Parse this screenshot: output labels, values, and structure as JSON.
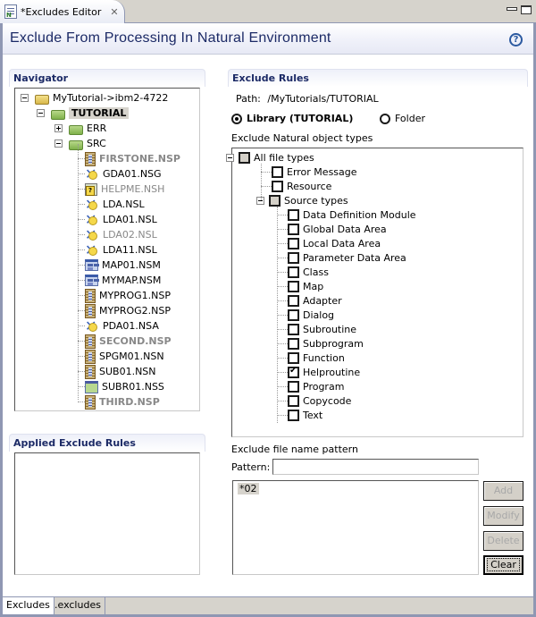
{
  "editor_tab": {
    "title": "*Excludes Editor",
    "close_glyph": "✕"
  },
  "header": {
    "title": "Exclude From Processing In Natural Environment",
    "help_glyph": "?"
  },
  "navigator": {
    "title": "Navigator",
    "items": [
      {
        "label": "MyTutorial->ibm2-4722",
        "icon": "project-folder-icon",
        "style": "normal"
      },
      {
        "label": "TUTORIAL",
        "icon": "library-folder-icon",
        "style": "bold-selected"
      },
      {
        "label": "ERR",
        "icon": "error-folder-icon",
        "style": "normal"
      },
      {
        "label": "SRC",
        "icon": "source-folder-icon",
        "style": "normal"
      },
      {
        "label": "FIRSTONE.NSP",
        "icon": "program-icon",
        "style": "bold-gray"
      },
      {
        "label": "GDA01.NSG",
        "icon": "data-area-icon",
        "style": "normal"
      },
      {
        "label": "HELPME.NSH",
        "icon": "helproutine-icon",
        "style": "gray"
      },
      {
        "label": "LDA.NSL",
        "icon": "data-area-icon",
        "style": "normal"
      },
      {
        "label": "LDA01.NSL",
        "icon": "data-area-icon",
        "style": "normal"
      },
      {
        "label": "LDA02.NSL",
        "icon": "data-area-icon",
        "style": "gray"
      },
      {
        "label": "LDA11.NSL",
        "icon": "data-area-icon",
        "style": "normal"
      },
      {
        "label": "MAP01.NSM",
        "icon": "map-icon",
        "style": "normal"
      },
      {
        "label": "MYMAP.NSM",
        "icon": "map-icon",
        "style": "normal"
      },
      {
        "label": "MYPROG1.NSP",
        "icon": "program-icon",
        "style": "normal"
      },
      {
        "label": "MYPROG2.NSP",
        "icon": "program-icon",
        "style": "normal"
      },
      {
        "label": "PDA01.NSA",
        "icon": "parameter-data-area-icon",
        "style": "normal"
      },
      {
        "label": "SECOND.NSP",
        "icon": "program-icon",
        "style": "bold-gray"
      },
      {
        "label": "SPGM01.NSN",
        "icon": "subprogram-icon",
        "style": "normal"
      },
      {
        "label": "SUB01.NSN",
        "icon": "subprogram-icon",
        "style": "normal"
      },
      {
        "label": "SUBR01.NSS",
        "icon": "subroutine-icon",
        "style": "normal"
      },
      {
        "label": "THIRD.NSP",
        "icon": "program-icon",
        "style": "bold-gray"
      }
    ]
  },
  "applied_rules": {
    "title": "Applied Exclude Rules",
    "items": []
  },
  "exclude_rules": {
    "title": "Exclude Rules",
    "path_label": "Path:",
    "path_value": "/MyTutorials/TUTORIAL",
    "radio_library": "Library (TUTORIAL)",
    "radio_folder": "Folder",
    "selected_scope": "library",
    "types_label": "Exclude Natural object types",
    "types": [
      {
        "label": "All file types",
        "state": "partial",
        "level": 0,
        "expandable": true
      },
      {
        "label": "Error Message",
        "state": "unchecked",
        "level": 1
      },
      {
        "label": "Resource",
        "state": "unchecked",
        "level": 1
      },
      {
        "label": "Source types",
        "state": "partial",
        "level": 1,
        "expandable": true
      },
      {
        "label": "Data Definition Module",
        "state": "unchecked",
        "level": 2
      },
      {
        "label": "Global Data Area",
        "state": "unchecked",
        "level": 2
      },
      {
        "label": "Local Data Area",
        "state": "unchecked",
        "level": 2
      },
      {
        "label": "Parameter Data Area",
        "state": "unchecked",
        "level": 2
      },
      {
        "label": "Class",
        "state": "unchecked",
        "level": 2
      },
      {
        "label": "Map",
        "state": "unchecked",
        "level": 2
      },
      {
        "label": "Adapter",
        "state": "unchecked",
        "level": 2
      },
      {
        "label": "Dialog",
        "state": "unchecked",
        "level": 2
      },
      {
        "label": "Subroutine",
        "state": "unchecked",
        "level": 2
      },
      {
        "label": "Subprogram",
        "state": "unchecked",
        "level": 2
      },
      {
        "label": "Function",
        "state": "unchecked",
        "level": 2
      },
      {
        "label": "Helproutine",
        "state": "checked",
        "level": 2
      },
      {
        "label": "Program",
        "state": "unchecked",
        "level": 2
      },
      {
        "label": "Copycode",
        "state": "unchecked",
        "level": 2
      },
      {
        "label": "Text",
        "state": "unchecked",
        "level": 2
      }
    ],
    "pattern_section_label": "Exclude file name pattern",
    "pattern_label": "Pattern:",
    "pattern_value": "",
    "patterns": [
      "*02"
    ],
    "buttons": {
      "add": "Add",
      "modify": "Modify",
      "delete": "Delete",
      "clear": "Clear"
    }
  },
  "bottom_tabs": [
    {
      "label": "Excludes",
      "active": true
    },
    {
      "label": ".excludes",
      "active": false
    }
  ]
}
